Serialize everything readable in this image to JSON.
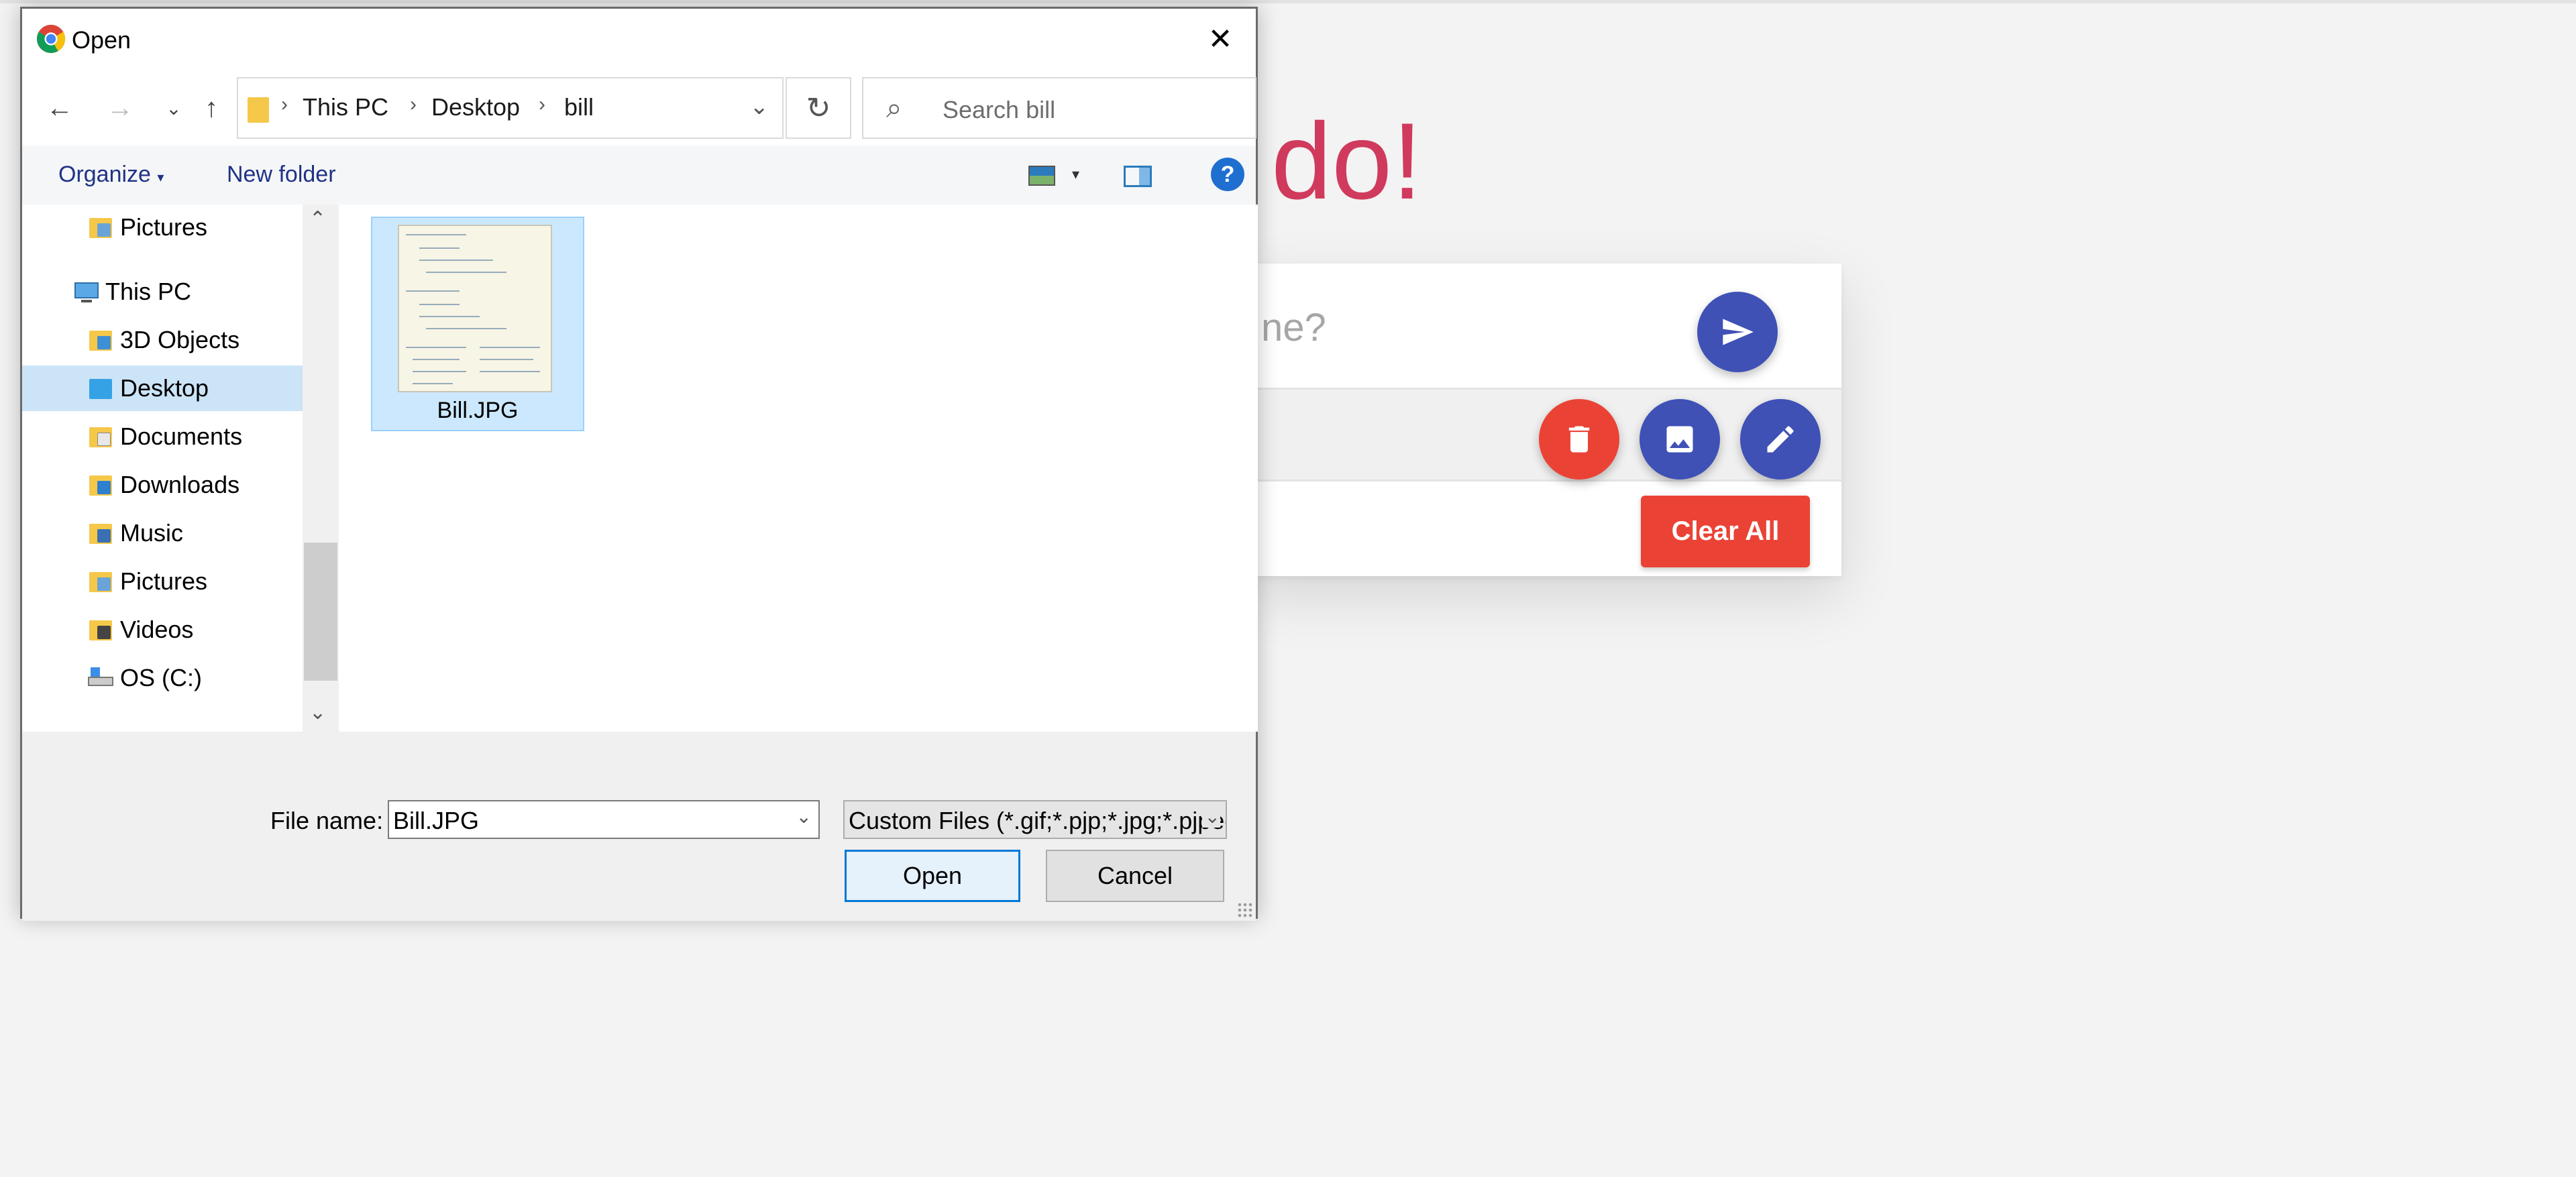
{
  "app": {
    "title_fragment": "do!",
    "input_placeholder_fragment": "ne?",
    "clear_all_label": "Clear All"
  },
  "dialog": {
    "title": "Open",
    "breadcrumb": [
      "This PC",
      "Desktop",
      "bill"
    ],
    "search_placeholder": "Search bill",
    "toolbar": {
      "organize_label": "Organize",
      "new_folder_label": "New folder",
      "help_label": "?"
    },
    "tree": [
      {
        "label": "Pictures",
        "icon": "pictures-folder-icon"
      },
      {
        "label": "This PC",
        "icon": "computer-icon"
      },
      {
        "label": "3D Objects",
        "icon": "3d-objects-folder-icon"
      },
      {
        "label": "Desktop",
        "icon": "desktop-folder-icon",
        "selected": true
      },
      {
        "label": "Documents",
        "icon": "documents-folder-icon"
      },
      {
        "label": "Downloads",
        "icon": "downloads-folder-icon"
      },
      {
        "label": "Music",
        "icon": "music-folder-icon"
      },
      {
        "label": "Pictures",
        "icon": "pictures-folder-icon"
      },
      {
        "label": "Videos",
        "icon": "videos-folder-icon"
      },
      {
        "label": "OS (C:)",
        "icon": "drive-icon"
      }
    ],
    "files": [
      {
        "name": "Bill.JPG",
        "selected": true
      }
    ],
    "file_name_label": "File name:",
    "file_name_value": "Bill.JPG",
    "filter_value": "Custom Files (*.gif;*.pjp;*.jpg;*.pjpeg)",
    "open_label": "Open",
    "cancel_label": "Cancel"
  },
  "colors": {
    "accent_blue": "#3f51b5",
    "danger_red": "#ea4335",
    "title_red": "#d03a5c",
    "selection_blue": "#cce8ff"
  }
}
